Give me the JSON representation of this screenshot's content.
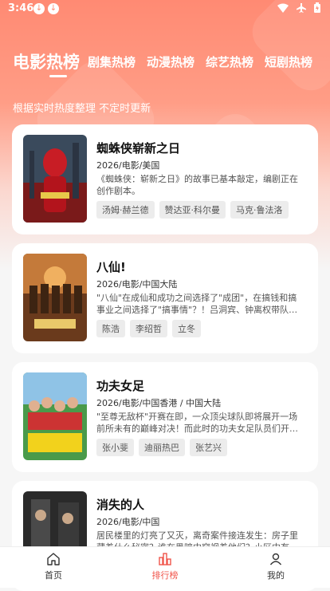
{
  "status_bar": {
    "time": "3:46"
  },
  "tabs": [
    "电影热榜",
    "剧集热榜",
    "动漫热榜",
    "综艺热榜",
    "短剧热榜"
  ],
  "subtitle": "根据实时热度整理 不定时更新",
  "movies": [
    {
      "title": "蜘蛛侠崭新之日",
      "meta": "2026/电影/美国",
      "desc": "《蜘蛛侠：崭新之日》的故事已基本敲定，编剧正在创作剧本。",
      "tags": [
        "汤姆·赫兰德",
        "赞达亚·科尔曼",
        "马克·鲁法洛"
      ]
    },
    {
      "title": "八仙!",
      "meta": "2026/电影/中国大陆",
      "desc": "\"八仙\"在成仙和成功之间选择了\"成团\"，在搞钱和搞事业之间选择了\"搞事情\"？！吕洞宾、钟离权带队，集…",
      "tags": [
        "陈浩",
        "李绍哲",
        "立冬"
      ]
    },
    {
      "title": "功夫女足",
      "meta": "2026/电影/中国香港 / 中国大陆",
      "desc": "\"至尊无敌杯\"开赛在即，一众顶尖球队即将展开一场前所未有的巅峰对决！而此时的功夫女足队员们开局直…",
      "tags": [
        "张小斐",
        "迪丽热巴",
        "张艺兴"
      ]
    },
    {
      "title": "消失的人",
      "meta": "2026/电影/中国",
      "desc": "居民楼里的灯亮了又灭，离奇案件接连发生：房子里藏着什么秘密？谁在黑暗中窥视着他们？小区中有个…",
      "tags": []
    }
  ],
  "bottom_nav": [
    {
      "label": "首页",
      "icon": "home-icon"
    },
    {
      "label": "排行榜",
      "icon": "chart-icon"
    },
    {
      "label": "我的",
      "icon": "user-icon"
    }
  ],
  "colors": {
    "accent": "#f0544a",
    "header_gradient_top": "#ff8a73"
  }
}
